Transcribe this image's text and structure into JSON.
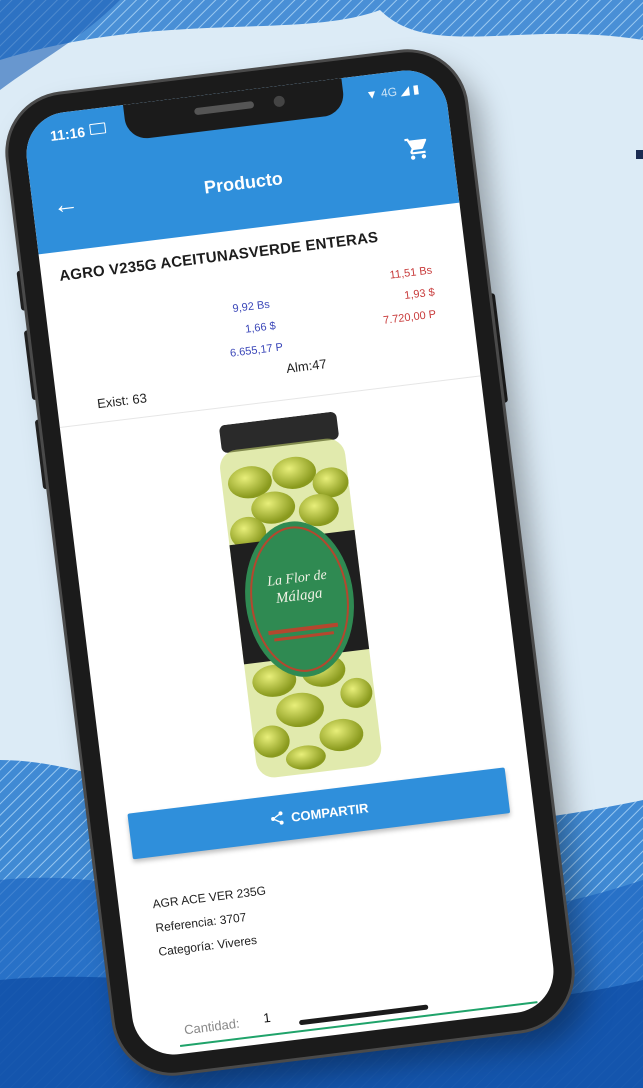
{
  "status_bar": {
    "time": "11:16",
    "network": "4G"
  },
  "app_bar": {
    "title": "Producto"
  },
  "product": {
    "name": "AGRO V235G ACEITUNASVERDE ENTERAS",
    "prices_blue": [
      "9,92 Bs",
      "1,66 $",
      "6.655,17 P"
    ],
    "prices_red": [
      "11,51 Bs",
      "1,93 $",
      "7.720,00 P"
    ],
    "exist": "Exist: 63",
    "alm": "Alm:47",
    "jar_label_line1": "La Flor de",
    "jar_label_line2": "Málaga",
    "short_name": "AGR ACE VER 235G",
    "reference": "Referencia: 3707",
    "category": "Categoría: Viveres"
  },
  "share_button": {
    "label": "COMPARTIR"
  },
  "quantity": {
    "label": "Cantidad:",
    "value": "1"
  },
  "colors": {
    "primary": "#2f8fdb",
    "price_blue": "#3a46b8",
    "price_red": "#c83a3a",
    "underline": "#1fa36a"
  },
  "icons": [
    "back-arrow-icon",
    "cart-icon",
    "share-icon",
    "laptop-icon",
    "wifi-icon",
    "signal-icon",
    "battery-icon"
  ]
}
